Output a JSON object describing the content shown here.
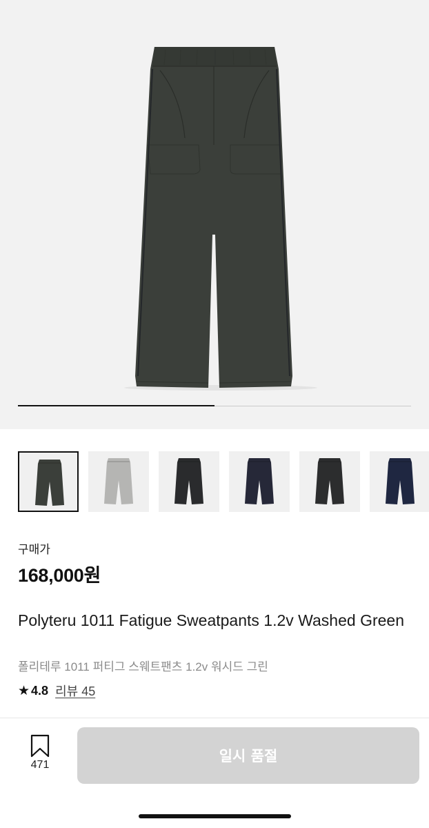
{
  "gallery": {
    "current_index": 1,
    "total_images": 2,
    "main_image": {
      "color_name": "Washed Green",
      "color": "#3b3f3a"
    }
  },
  "thumbnails": [
    {
      "color": "#3b3f3a",
      "selected": true
    },
    {
      "color": "#b5b5b3",
      "selected": false
    },
    {
      "color": "#2a2b2d",
      "selected": false
    },
    {
      "color": "#262838",
      "selected": false
    },
    {
      "color": "#2c2d2e",
      "selected": false
    },
    {
      "color": "#1f2741",
      "selected": false
    }
  ],
  "product": {
    "price_label": "구매가",
    "price": "168,000원",
    "title": "Polyteru 1011 Fatigue Sweatpants 1.2v Washed Green",
    "subtitle": "폴리테루 1011 퍼티그 스웨트팬츠 1.2v 워시드 그린",
    "rating_icon": "star-icon",
    "rating": "4.8",
    "review_label": "리뷰 45"
  },
  "actions": {
    "wishlist_icon": "bookmark-icon",
    "wishlist_count": "471",
    "soldout_label": "일시 품절",
    "disabled_color": "#d3d3d3"
  }
}
